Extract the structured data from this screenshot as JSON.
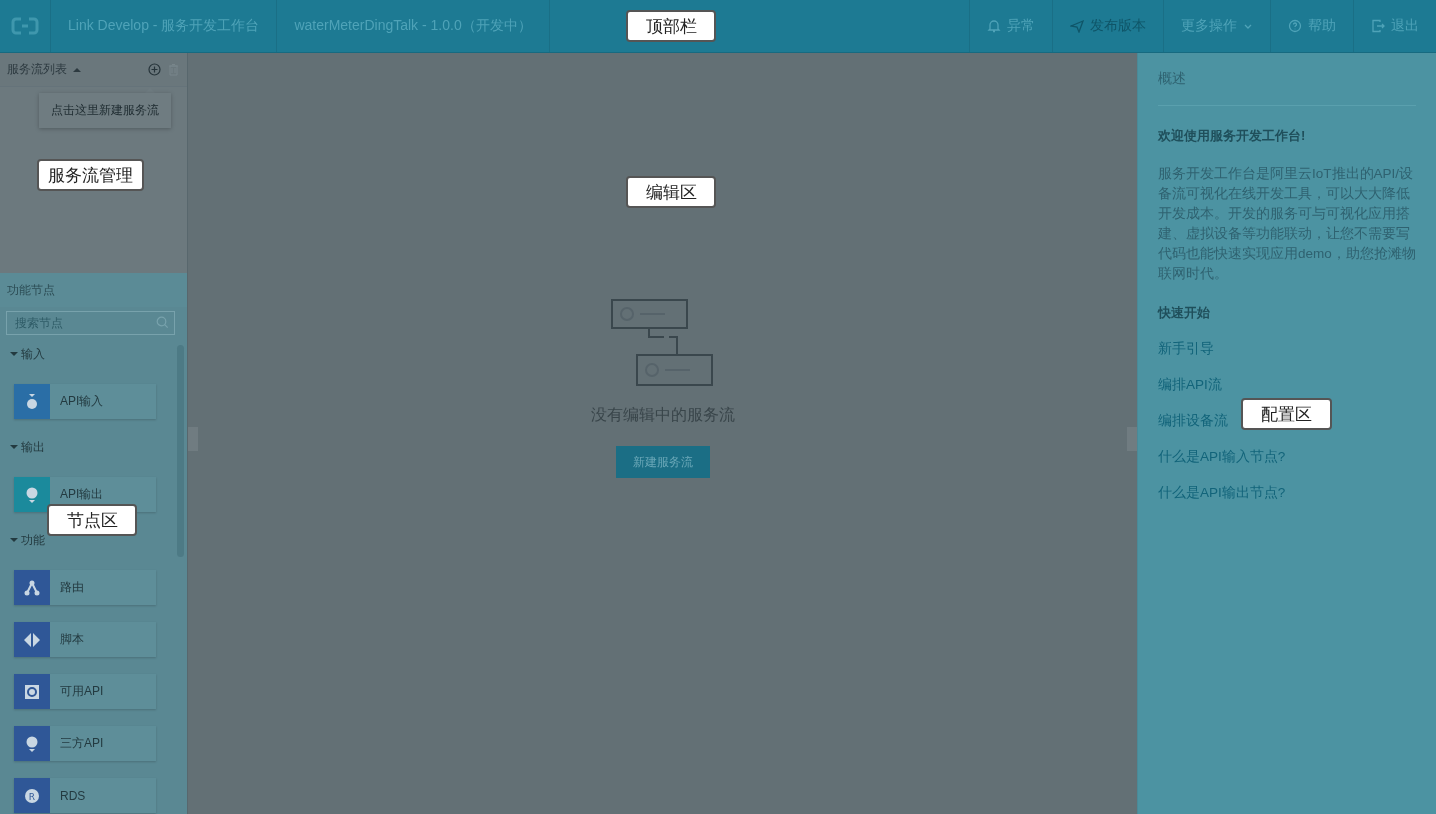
{
  "top_bar": {
    "app_title": "Link Develop - 服务开发工作台",
    "project": "waterMeterDingTalk - 1.0.0（开发中）",
    "actions": [
      {
        "kind": "bell",
        "label": "异常",
        "disabled": false
      },
      {
        "kind": "send",
        "label": "发布版本",
        "disabled": true
      },
      {
        "kind": "dropdown",
        "label": "更多操作",
        "disabled": false
      },
      {
        "kind": "help",
        "label": "帮助",
        "disabled": false
      },
      {
        "kind": "exit",
        "label": "退出",
        "disabled": false
      }
    ]
  },
  "flow_list": {
    "title": "服务流列表",
    "expanded": true,
    "tooltip": "点击这里新建服务流"
  },
  "node_panel": {
    "title": "功能节点",
    "search": {
      "placeholder": "搜索节点"
    },
    "groups": [
      {
        "label": "输入",
        "expanded": true,
        "nodes": [
          {
            "label": "API输入",
            "kind": "api_in",
            "color": "#2a6ea6"
          }
        ]
      },
      {
        "label": "输出",
        "expanded": true,
        "nodes": [
          {
            "label": "API输出",
            "kind": "api_out",
            "color": "#1b8a9c"
          }
        ]
      },
      {
        "label": "功能",
        "expanded": true,
        "nodes": [
          {
            "label": "路由",
            "kind": "router",
            "color": "#2f5797"
          },
          {
            "label": "脚本",
            "kind": "script",
            "color": "#2f5797"
          },
          {
            "label": "可用API",
            "kind": "api",
            "color": "#2f5797"
          },
          {
            "label": "三方API",
            "kind": "third",
            "color": "#2f5797"
          },
          {
            "label": "RDS",
            "kind": "rds",
            "color": "#2f5797",
            "glyph": "R"
          }
        ]
      }
    ]
  },
  "editor": {
    "empty_text": "没有编辑中的服务流",
    "button": "新建服务流"
  },
  "config_panel": {
    "tab": "概述",
    "welcome": "欢迎使用服务开发工作台!",
    "intro": "服务开发工作台是阿里云IoT推出的API/设备流可视化在线开发工具，可以大大降低开发成本。开发的服务可与可视化应用搭建、虚拟设备等功能联动，让您不需要写代码也能快速实现应用demo，助您抢滩物联网时代。",
    "quick_start": "快速开始",
    "links": [
      "新手引导",
      "编排API流",
      "编排设备流",
      "什么是API输入节点?",
      "什么是API输出节点?"
    ]
  },
  "callouts": [
    {
      "label": "顶部栏"
    },
    {
      "label": "服务流管理"
    },
    {
      "label": "编辑区"
    },
    {
      "label": "节点区"
    },
    {
      "label": "配置区"
    }
  ]
}
